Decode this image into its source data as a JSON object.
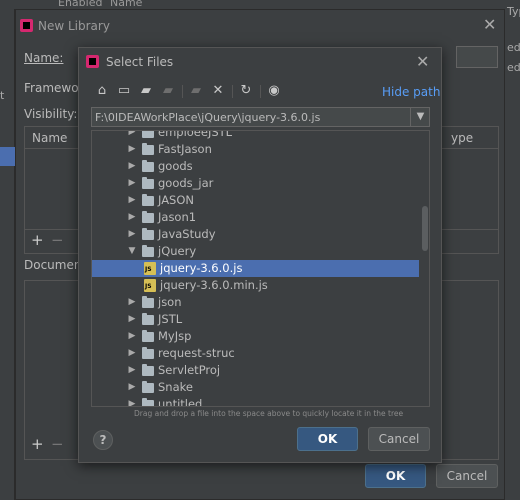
{
  "background": {
    "top_headers": [
      "Enabled",
      "Name"
    ],
    "right_fragments": [
      "Typ",
      "ed",
      "ed"
    ],
    "left_fragment": "t"
  },
  "new_library": {
    "title": "New Library",
    "name_label": "Name:",
    "framework_label": "Framework",
    "visibility_label": "Visibility:",
    "table_headers": [
      "Name",
      "ype"
    ],
    "add": "+",
    "remove": "−",
    "documentation_label": "Documenta",
    "ok": "OK",
    "cancel": "Cancel"
  },
  "select_files": {
    "title": "Select Files",
    "toolbar_icons": [
      "home-icon",
      "desktop-icon",
      "project-folder-icon",
      "module-folder-icon",
      "new-folder-icon",
      "delete-icon",
      "refresh-icon",
      "show-hidden-icon"
    ],
    "hide_path": "Hide path",
    "path_value": "F:\\0IDEAWorkPlace\\jQuery\\jquery-3.6.0.js",
    "tree": [
      {
        "name": "emploeeJSTL",
        "kind": "folder",
        "expanded": false,
        "depth": 0
      },
      {
        "name": "FastJason",
        "kind": "folder",
        "expanded": false,
        "depth": 0
      },
      {
        "name": "goods",
        "kind": "folder",
        "expanded": false,
        "depth": 0
      },
      {
        "name": "goods_jar",
        "kind": "folder",
        "expanded": false,
        "depth": 0
      },
      {
        "name": "JASON",
        "kind": "folder",
        "expanded": false,
        "depth": 0
      },
      {
        "name": "Jason1",
        "kind": "folder",
        "expanded": false,
        "depth": 0
      },
      {
        "name": "JavaStudy",
        "kind": "folder",
        "expanded": false,
        "depth": 0
      },
      {
        "name": "jQuery",
        "kind": "folder",
        "expanded": true,
        "depth": 0
      },
      {
        "name": "jquery-3.6.0.js",
        "kind": "js",
        "depth": 1,
        "selected": true
      },
      {
        "name": "jquery-3.6.0.min.js",
        "kind": "js",
        "depth": 1
      },
      {
        "name": "json",
        "kind": "folder",
        "expanded": false,
        "depth": 0
      },
      {
        "name": "JSTL",
        "kind": "folder",
        "expanded": false,
        "depth": 0
      },
      {
        "name": "MyJsp",
        "kind": "folder",
        "expanded": false,
        "depth": 0
      },
      {
        "name": "request-struc",
        "kind": "folder",
        "expanded": false,
        "depth": 0
      },
      {
        "name": "ServletProj",
        "kind": "folder",
        "expanded": false,
        "depth": 0
      },
      {
        "name": "Snake",
        "kind": "folder",
        "expanded": false,
        "depth": 0
      },
      {
        "name": "untitled",
        "kind": "folder",
        "expanded": false,
        "depth": 0
      }
    ],
    "hint": "Drag and drop a file into the space above to quickly locate it in the tree",
    "help": "?",
    "ok": "OK",
    "cancel": "Cancel"
  }
}
